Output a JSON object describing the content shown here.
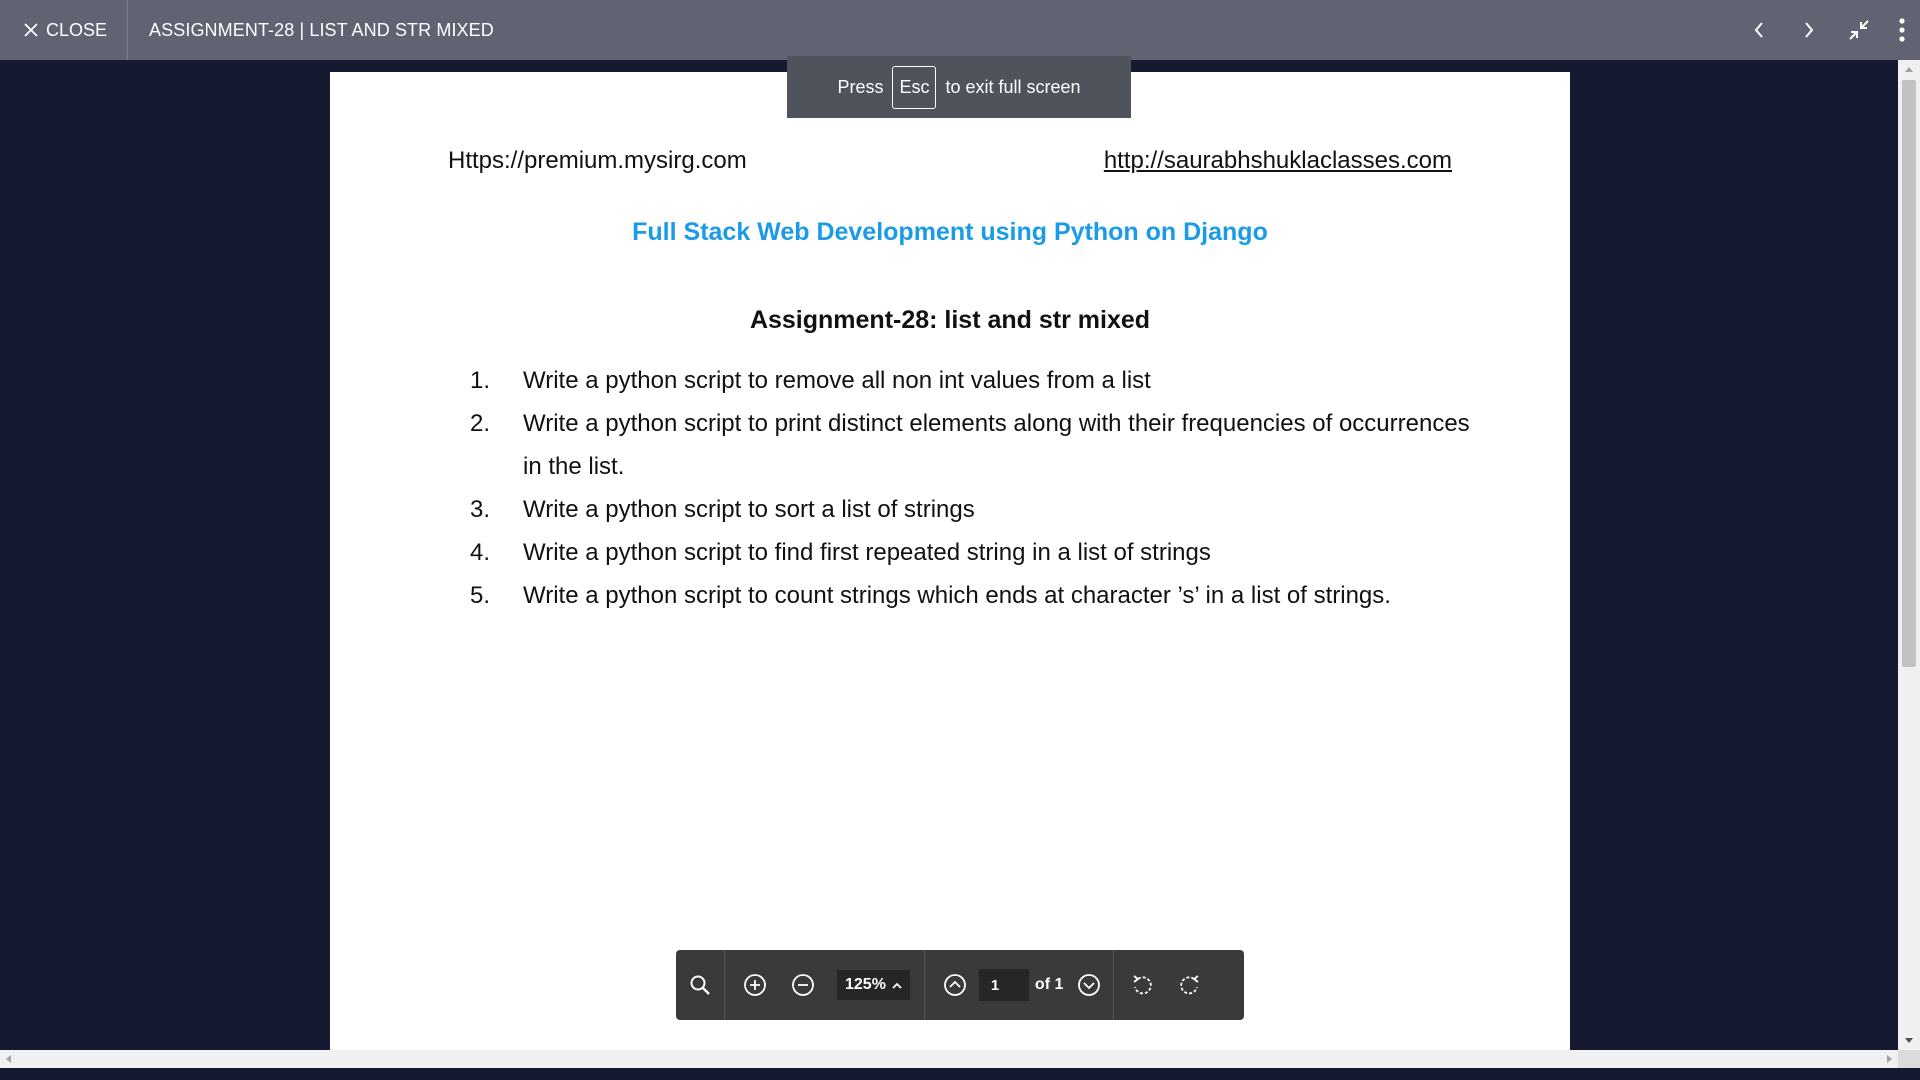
{
  "topbar": {
    "close_label": "CLOSE",
    "title": "ASSIGNMENT-28 | LIST AND STR MIXED"
  },
  "toast": {
    "prefix": "Press",
    "key": "Esc",
    "suffix": "to exit full screen"
  },
  "document": {
    "header_left": "Https://premium.mysirg.com",
    "header_right": "http://saurabhshuklaclasses.com",
    "course_title": "Full Stack Web Development using Python on Django",
    "assignment_title": "Assignment-28: list and str mixed",
    "tasks": [
      {
        "num": "1.",
        "text": "Write a python script to remove all non int values from a list"
      },
      {
        "num": "2.",
        "text": "Write a python script to print distinct elements along with their frequencies of occurrences in the list."
      },
      {
        "num": "3.",
        "text": "Write a python script to sort a list of strings"
      },
      {
        "num": "4.",
        "text": "Write a python script to find first repeated string in a list of strings"
      },
      {
        "num": "5.",
        "text": "Write a python script to count strings which ends at character ’s’ in a list of strings."
      }
    ]
  },
  "toolbar": {
    "zoom": "125%",
    "page_current": "1",
    "page_total_label": "of 1"
  },
  "colors": {
    "topbar_bg": "#5f6372",
    "backdrop": "#151a30",
    "course_title": "#1a9be8",
    "toolbar_bg": "#3a3a3d"
  },
  "icons": {
    "close": "close-icon",
    "prev": "chevron-left-icon",
    "next": "chevron-right-icon",
    "exit_fullscreen": "exit-fullscreen-icon",
    "more": "more-vertical-icon",
    "search": "search-icon",
    "zoom_in": "zoom-in-icon",
    "zoom_out": "zoom-out-icon",
    "page_up": "page-up-icon",
    "page_down": "page-down-icon",
    "rotate_left": "rotate-left-icon",
    "rotate_right": "rotate-right-icon"
  }
}
